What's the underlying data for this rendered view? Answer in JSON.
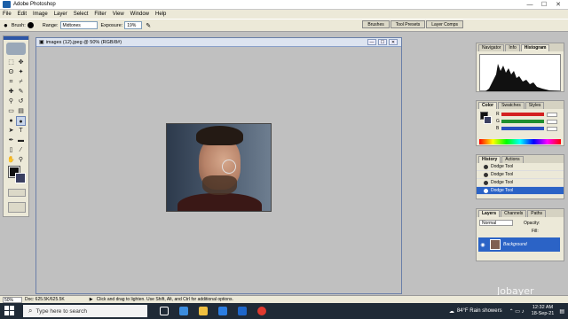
{
  "titlebar": {
    "title": "Adobe Photoshop",
    "minimize": "—",
    "maximize": "☐",
    "close": "✕"
  },
  "menu": [
    "File",
    "Edit",
    "Image",
    "Layer",
    "Select",
    "Filter",
    "View",
    "Window",
    "Help"
  ],
  "options": {
    "brush_label": "Brush:",
    "range_label": "Range:",
    "range_value": "Midtones",
    "exposure_label": "Exposure:",
    "exposure_value": "19%"
  },
  "wells": [
    "Brushes",
    "Tool Presets",
    "Layer Comps"
  ],
  "document": {
    "title": "images (12).jpeg @ 50% (RGB/8#)"
  },
  "panels": {
    "navigator_tabs": [
      "Navigator",
      "Info",
      "Histogram"
    ],
    "color_tabs": [
      "Color",
      "Swatches",
      "Styles"
    ],
    "color_channels": [
      {
        "label": "R",
        "color": "#d32020"
      },
      {
        "label": "G",
        "color": "#1f8f2f"
      },
      {
        "label": "B",
        "color": "#2a4fc0"
      }
    ],
    "history_tabs": [
      "History",
      "Actions"
    ],
    "history_items": [
      "Dodge Tool",
      "Dodge Tool",
      "Dodge Tool",
      "Dodge Tool"
    ],
    "layers_tabs": [
      "Layers",
      "Channels",
      "Paths"
    ],
    "blend_mode": "Normal",
    "opacity_label": "Opacity:",
    "fill_label": "Fill:",
    "layer_name": "Background"
  },
  "status": {
    "zoom": "50%",
    "doc": "Doc: 625.5K/625.5K",
    "hint": "Click and drag to lighten. Use Shift, Alt, and Ctrl for additional options."
  },
  "taskbar": {
    "search_placeholder": "Type here to search",
    "weather": "84°F  Rain showers",
    "time": "12:32 AM",
    "date": "18-Sep-21"
  },
  "watermark": "Jobayer"
}
